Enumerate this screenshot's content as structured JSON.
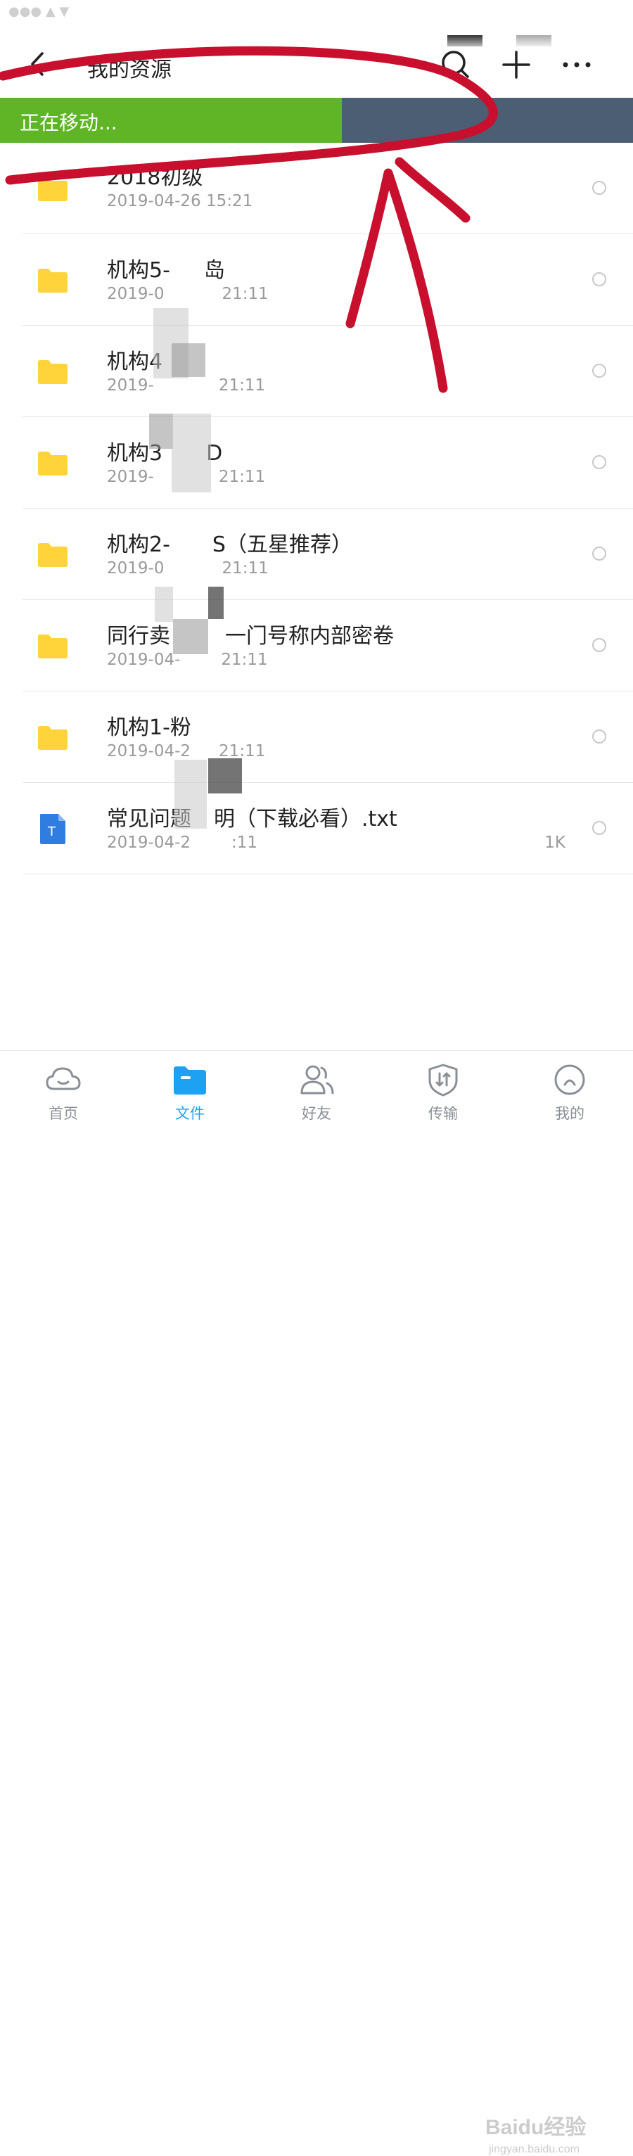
{
  "header": {
    "title": "我的资源",
    "icons": [
      "back-icon",
      "search-icon",
      "plus-icon",
      "more-icon"
    ]
  },
  "progress": {
    "label": "正在移动...",
    "fraction": 0.54,
    "fill_color": "#5fb526",
    "track_color": "#4c5e74"
  },
  "files": [
    {
      "name": "2018初级",
      "date": "2019-04-26 15:21",
      "size": "",
      "type": "folder"
    },
    {
      "name": "机构5-",
      "name2": "岛",
      "date": "2019-0",
      "date2": "21:11",
      "size": "",
      "type": "folder"
    },
    {
      "name": "机构4",
      "name2": "",
      "date": "2019-",
      "date2": "21:11",
      "size": "",
      "type": "folder"
    },
    {
      "name": "机构3",
      "name2": "D",
      "date": "2019-",
      "date2": "21:11",
      "size": "",
      "type": "folder"
    },
    {
      "name": "机构2-",
      "name2": "S（五星推荐）",
      "date": "2019-0",
      "date2": "21:11",
      "size": "",
      "type": "folder"
    },
    {
      "name": "同行卖",
      "name2": "一门号称内部密卷",
      "date": "2019-04-",
      "date2": "21:11",
      "size": "",
      "type": "folder"
    },
    {
      "name": "机构1-粉",
      "name2": "",
      "date": "2019-04-2",
      "date2": "21:11",
      "size": "",
      "type": "folder"
    },
    {
      "name": "常见问题",
      "name2": "明（下载必看）.txt",
      "date": "2019-04-2",
      "date2": ":11",
      "size": "1K",
      "type": "txt"
    }
  ],
  "tabs": [
    {
      "label": "首页",
      "icon": "cloud-icon",
      "active": false
    },
    {
      "label": "文件",
      "icon": "folder-icon",
      "active": true
    },
    {
      "label": "好友",
      "icon": "friends-icon",
      "active": false
    },
    {
      "label": "传输",
      "icon": "transfer-icon",
      "active": false
    },
    {
      "label": "我的",
      "icon": "profile-icon",
      "active": false
    }
  ],
  "colors": {
    "accent": "#1da1f2",
    "folder": "#ffd43b",
    "annotation": "#c8102e"
  },
  "watermark": {
    "text": "Baidu经验",
    "sub": "jingyan.baidu.com"
  }
}
